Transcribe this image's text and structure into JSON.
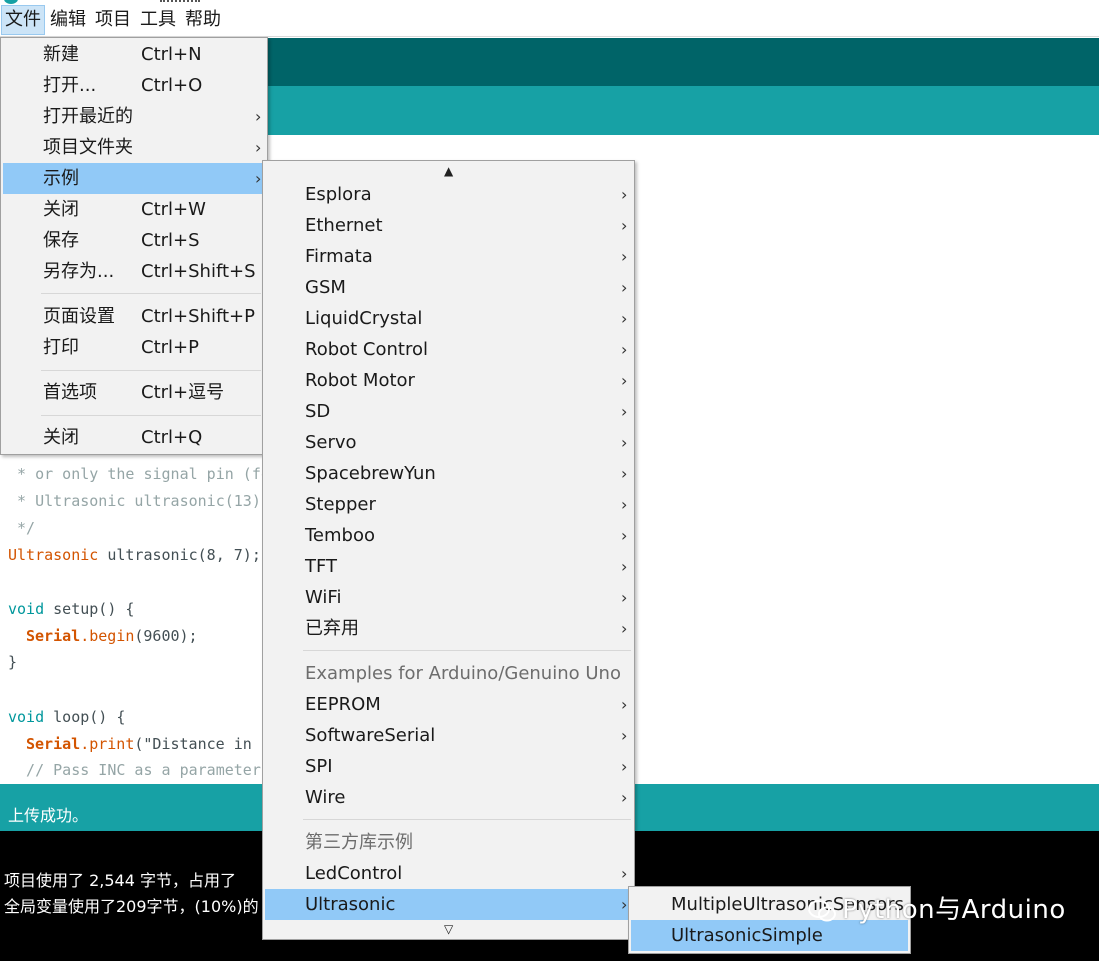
{
  "menubar": {
    "items": [
      "文件",
      "编辑",
      "项目",
      "工具",
      "帮助"
    ]
  },
  "file_menu": {
    "items": [
      {
        "label": "新建",
        "shortcut": "Ctrl+N"
      },
      {
        "label": "打开...",
        "shortcut": "Ctrl+O"
      },
      {
        "label": "打开最近的",
        "shortcut": ""
      },
      {
        "label": "项目文件夹",
        "shortcut": ""
      },
      {
        "label": "示例",
        "shortcut": ""
      },
      {
        "label": "关闭",
        "shortcut": "Ctrl+W"
      },
      {
        "label": "保存",
        "shortcut": "Ctrl+S"
      },
      {
        "label": "另存为...",
        "shortcut": "Ctrl+Shift+S"
      },
      {
        "label": "页面设置",
        "shortcut": "Ctrl+Shift+P"
      },
      {
        "label": "打印",
        "shortcut": "Ctrl+P"
      },
      {
        "label": "首选项",
        "shortcut": "Ctrl+逗号"
      },
      {
        "label": "关闭",
        "shortcut": "Ctrl+Q"
      }
    ]
  },
  "examples_menu": {
    "scroll_up": "▲",
    "scroll_down": "▽",
    "items": [
      "Esplora",
      "Ethernet",
      "Firmata",
      "GSM",
      "LiquidCrystal",
      "Robot Control",
      "Robot Motor",
      "SD",
      "Servo",
      "SpacebrewYun",
      "Stepper",
      "Temboo",
      "TFT",
      "WiFi",
      "已弃用"
    ],
    "board_header": "Examples for Arduino/Genuino Uno",
    "board_items": [
      "EEPROM",
      "SoftwareSerial",
      "SPI",
      "Wire"
    ],
    "third_party_header": "第三方库示例",
    "third_party_items": [
      "LedControl",
      "Ultrasonic"
    ]
  },
  "ultrasonic_menu": {
    "items": [
      "MultipleUltrasonicSensors",
      "UltrasonicSimple"
    ]
  },
  "editor": {
    "lines": [
      " * or only the signal pin (fo",
      " * Ultrasonic ultrasonic(13)",
      " */",
      "Ultrasonic",
      " ultrasonic(8, 7);",
      "void",
      " setup() {",
      "Serial",
      ".begin",
      "(9600);",
      "}",
      "void",
      " loop() {",
      "Serial",
      ".print",
      "(\"Distance in",
      "  // Pass INC as a parameter"
    ]
  },
  "status": {
    "message": "上传成功。"
  },
  "console": {
    "lines": [
      "项目使用了 2,544 字节，占用了",
      "全局变量使用了209字节，(10%)的"
    ]
  },
  "watermark": {
    "text": "Python与Arduino"
  },
  "colors": {
    "teal_dark": "#006468",
    "teal": "#17a1a5",
    "highlight": "#91c9f7",
    "menu_bg": "#f2f2f2"
  }
}
